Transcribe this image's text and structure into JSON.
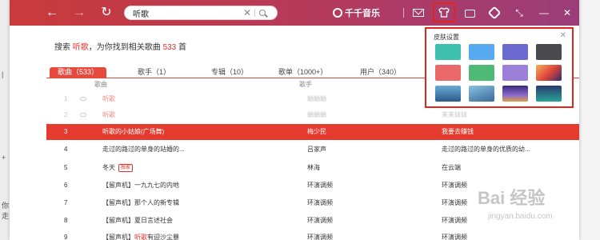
{
  "search": {
    "value": "听歌",
    "clear": "✕"
  },
  "nav": {
    "back": "←",
    "forward": "→",
    "refresh": "↻"
  },
  "app": {
    "title": "千千音乐"
  },
  "window": {
    "minimize": "—",
    "close": "✕",
    "shrink": "⤡"
  },
  "left_labels": [
    "|",
    "+",
    "你走"
  ],
  "summary": {
    "prefix": "搜索",
    "query": "听歌",
    "middle": "，为你找到相关歌曲",
    "count": "533",
    "suffix": "首"
  },
  "tabs": [
    {
      "label": "歌曲（533）"
    },
    {
      "label": "歌手（1）"
    },
    {
      "label": "专辑（10）"
    },
    {
      "label": "歌单（1000+）"
    },
    {
      "label": "用户（340）"
    }
  ],
  "columns": {
    "title": "歌曲",
    "singer": "歌手"
  },
  "rows": [
    {
      "idx": "1",
      "title": "听歌",
      "singer": "蛐蛐蛐",
      "album": ""
    },
    {
      "idx": "2",
      "title": "听歌",
      "singer": "蛐蛐蛐",
      "album": "来来妹妹"
    },
    {
      "idx": "3",
      "title": "听歌的小姑娘(广场舞)",
      "singer": "梅少民",
      "album": "我要去赚钱"
    },
    {
      "idx": "4",
      "title": "走过的路过的单身的站婚的...",
      "singer": "吕家声",
      "album": "走过的路过的单身的优质的幼..."
    },
    {
      "idx": "5",
      "title": "冬天",
      "tag": "独家",
      "singer": "林海",
      "album": "在云端"
    },
    {
      "idx": "6",
      "title": "【留声机】一九九七的内地",
      "singer": "环演调频",
      "album": "环演调频"
    },
    {
      "idx": "7",
      "title": "【留声机】那个人的新专辑",
      "singer": "环演调频",
      "album": "环演调频"
    },
    {
      "idx": "8",
      "title": "【留声机】夏日言述社会",
      "singer": "环演调频",
      "album": "环演调频"
    },
    {
      "idx": "9",
      "title_prefix": "【留声机】",
      "title_hl": "听歌",
      "title_suffix": "有迎沙尘暴",
      "singer": "环演调频",
      "album": "环演调频"
    }
  ],
  "skin_popup": {
    "title": "皮肤设置",
    "close": "✕",
    "swatches": [
      "#3fbfb0",
      "#56aaf0",
      "#6a6ad0",
      "#4a4a4e",
      "#ea6a6a",
      "#4fba78",
      "#9b7fd8",
      "#e25a3a",
      "#2a6aa0",
      "#4a88b4",
      "#6a4ab0",
      "#2aa39a"
    ]
  },
  "watermark": {
    "brand": "Bai 经验",
    "url": "jingyan.baidu.com"
  }
}
